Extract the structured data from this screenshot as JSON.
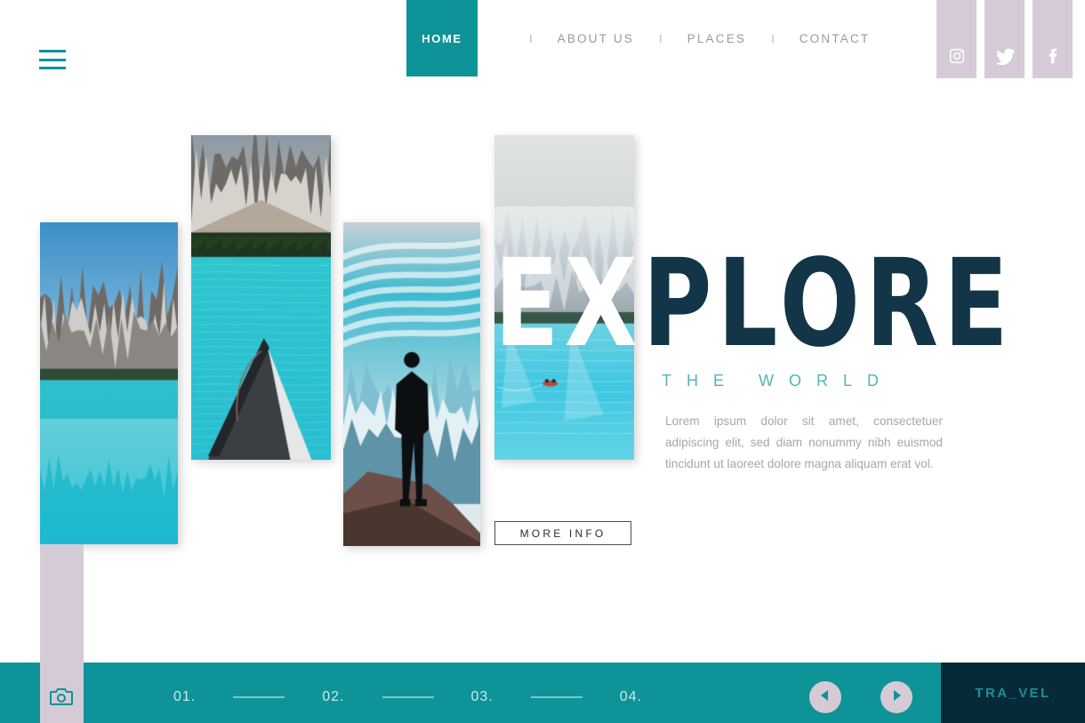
{
  "theme": {
    "teal": "#0d9398",
    "navy": "#072a38",
    "mauve": "#d4cbd6",
    "headline_dark": "#123548",
    "subhead_teal": "#52b5b5",
    "body_gray": "#a7a7ac"
  },
  "header": {
    "menu_icon": "hamburger-icon",
    "nav": {
      "active": "HOME",
      "separator": "I",
      "items": [
        {
          "label": "HOME",
          "active": true
        },
        {
          "label": "ABOUT US",
          "active": false
        },
        {
          "label": "PLACES",
          "active": false
        },
        {
          "label": "CONTACT",
          "active": false
        }
      ]
    },
    "social": [
      {
        "name": "instagram-icon"
      },
      {
        "name": "twitter-icon"
      },
      {
        "name": "facebook-icon"
      }
    ]
  },
  "hero": {
    "title_light": "EX",
    "title_dark": "PLORE",
    "subtitle": "THE WORLD",
    "paragraph": "Lorem ipsum dolor sit amet, consectetuer adipiscing elit, sed diam nonummy nibh euismod tincidunt ut laoreet dolore magna aliquam erat vol.",
    "cta_label": "MORE INFO",
    "gallery": [
      {
        "name": "photo-mountain-lake",
        "alt": "Snowy mountain peaks reflected in turquoise glacial lake"
      },
      {
        "name": "photo-canoe-lake",
        "alt": "Canoe bow on turquoise lake with pine forest and mountains"
      },
      {
        "name": "photo-hiker-silhouette",
        "alt": "Silhouette of hiker on rock facing snowy mountain range"
      },
      {
        "name": "photo-aerial-lake",
        "alt": "Aerial view of misty turquoise lake with small red canoe"
      }
    ]
  },
  "footer": {
    "camera_icon": "camera-icon",
    "pager": [
      "01.",
      "02.",
      "03.",
      "04."
    ],
    "prev_icon": "play-left-icon",
    "next_icon": "play-right-icon",
    "brand": "TRA_VEL"
  }
}
